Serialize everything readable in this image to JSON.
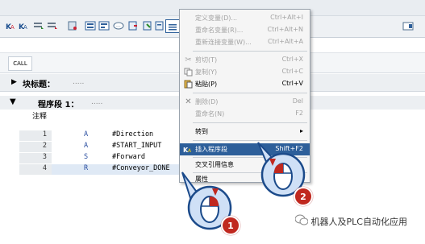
{
  "call_tab": "CALL",
  "block_title": {
    "label": "块标题：",
    "dots": "....."
  },
  "network": {
    "label": "程序段 1：",
    "dots": "....."
  },
  "comment_label": "注释",
  "code_rows": [
    {
      "line": "1",
      "op": "A",
      "arg": "#Direction"
    },
    {
      "line": "2",
      "op": "A",
      "arg": "#START_INPUT"
    },
    {
      "line": "3",
      "op": "S",
      "arg": "#Forward"
    },
    {
      "line": "4",
      "op": "R",
      "arg": "#Conveyor_DONE"
    }
  ],
  "menu": {
    "define_var": {
      "label": "定义变量(D)...",
      "shortcut": "Ctrl+Alt+I"
    },
    "rename_var": {
      "label": "重命名变量(R)...",
      "shortcut": "Ctrl+Alt+N"
    },
    "rewire_var": {
      "label": "重新连接变量(W)...",
      "shortcut": "Ctrl+Alt+A"
    },
    "cut": {
      "label": "剪切(T)",
      "shortcut": "Ctrl+X"
    },
    "copy": {
      "label": "复制(Y)",
      "shortcut": "Ctrl+C"
    },
    "paste": {
      "label": "粘贴(P)",
      "shortcut": "Ctrl+V"
    },
    "delete": {
      "label": "删除(D)",
      "shortcut": "Del"
    },
    "rename": {
      "label": "重命名(N)",
      "shortcut": "F2"
    },
    "goto": {
      "label": "转到",
      "arrow": "▸"
    },
    "insert_network": {
      "label": "插入程序段",
      "shortcut": "Shift+F2"
    },
    "xref": {
      "label": "交叉引用信息",
      "shortcut": ""
    },
    "properties": {
      "label": "属性",
      "shortcut": ""
    }
  },
  "callouts": {
    "one": "1",
    "two": "2"
  },
  "watermark": "机器人及PLC自动化应用",
  "colors": {
    "highlight": "#2d5f9a",
    "badge": "#c0281f"
  },
  "icons": [
    "cut-icon",
    "copy-icon",
    "paste-icon",
    "delete-icon",
    "insert-network-icon",
    "wechat-icon"
  ]
}
